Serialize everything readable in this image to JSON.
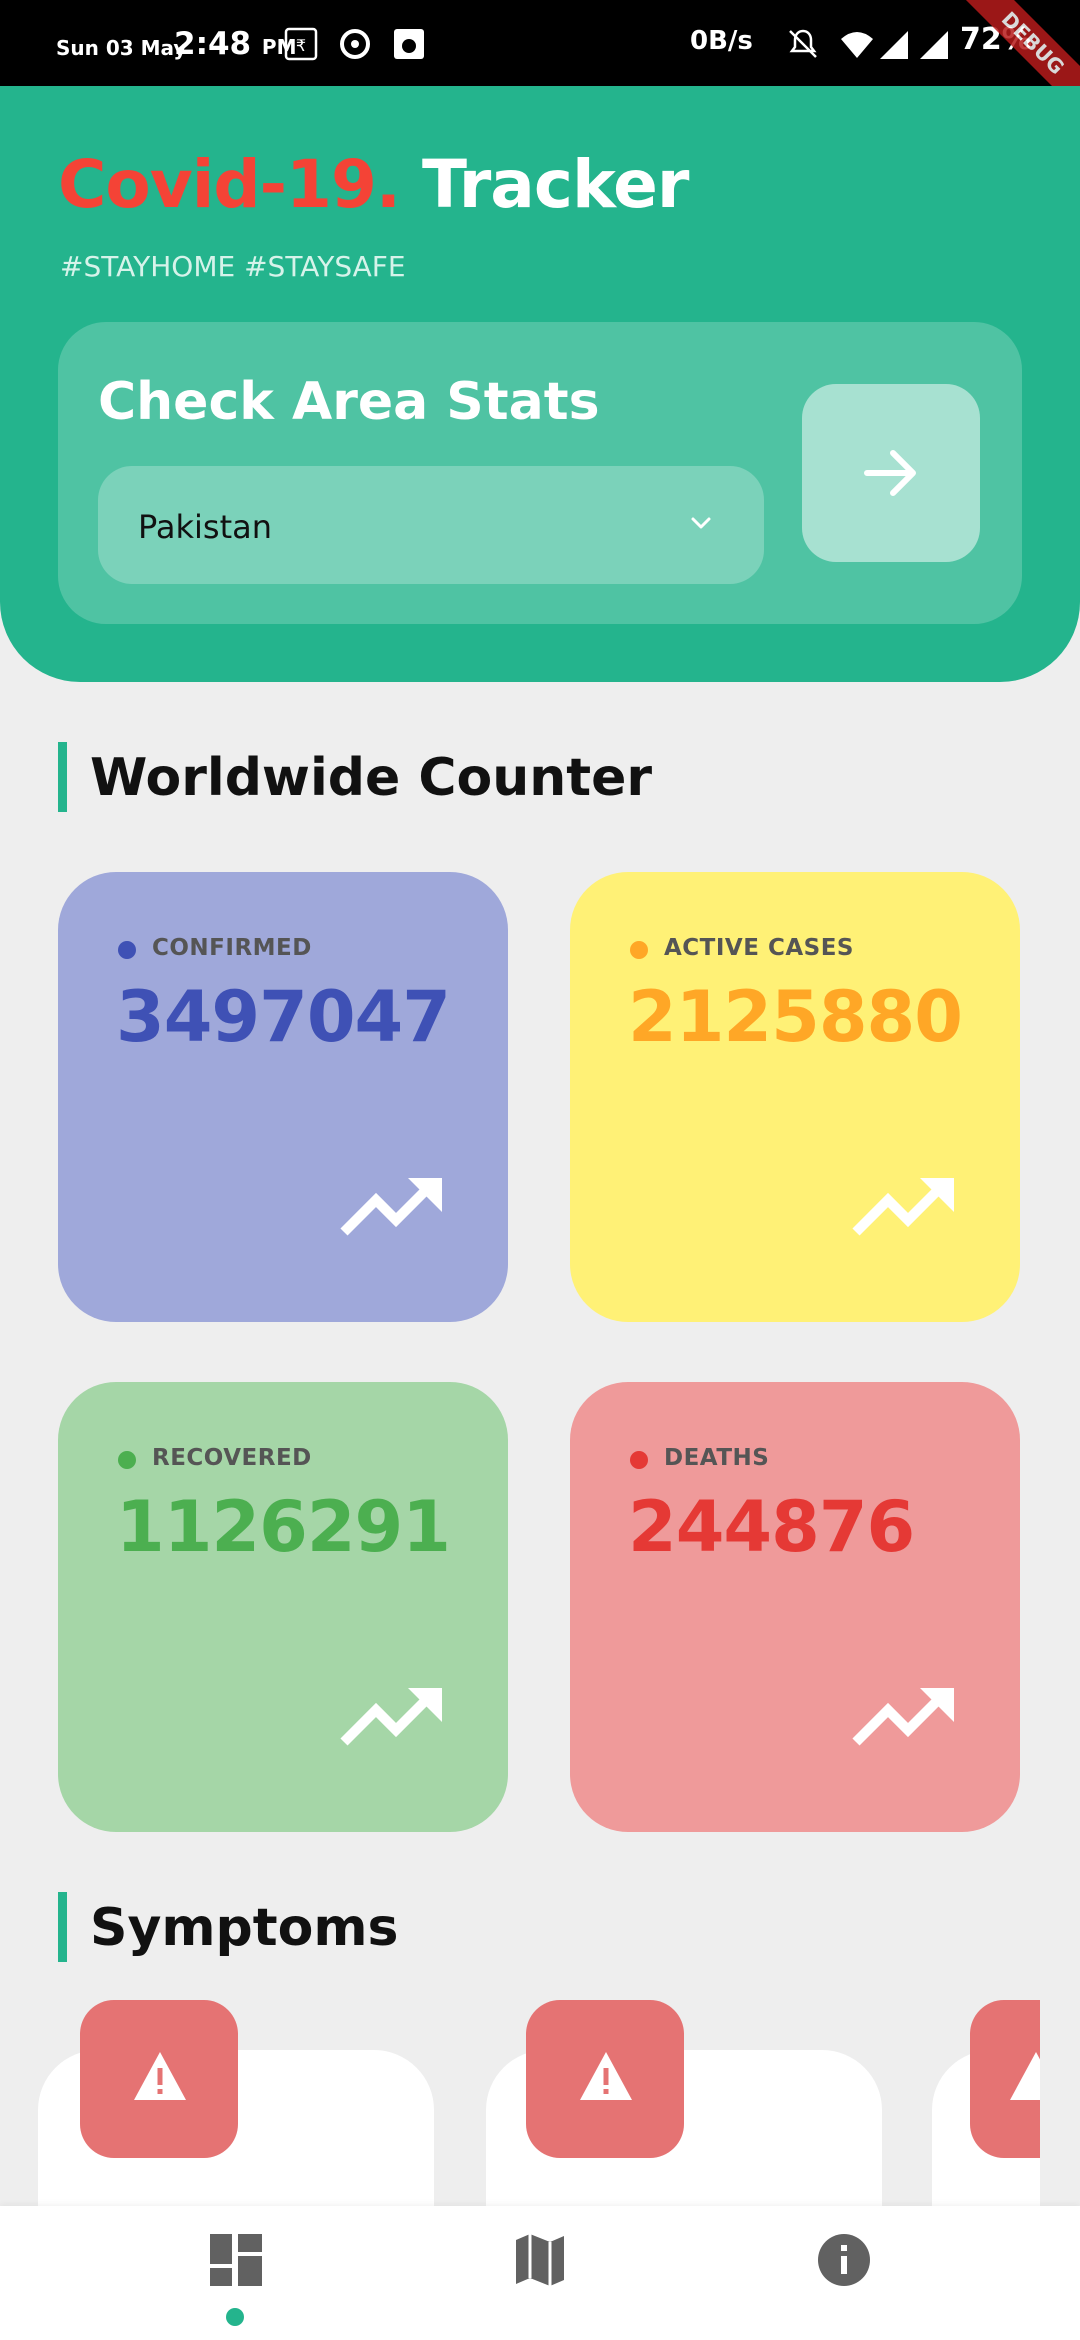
{
  "status_bar": {
    "date": "Sun 03 May",
    "time": "2:48",
    "ampm": "PM",
    "speed": "0B/s",
    "battery": "72%",
    "debug_banner": "DEBUG"
  },
  "header": {
    "title_part1": "Covid-19",
    "title_dot": ".",
    "title_part2": "Tracker",
    "hashtags": "#STAYHOME #STAYSAFE",
    "area_title": "Check Area Stats",
    "selected_country": "Pakistan",
    "colors": {
      "background": "#24b48d",
      "title_accent": "#f44336"
    }
  },
  "worldwide": {
    "heading": "Worldwide Counter",
    "cards": [
      {
        "label": "CONFIRMED",
        "value": "3497047",
        "bg": "#9fa8da",
        "accent": "#3f51b5"
      },
      {
        "label": "ACTIVE CASES",
        "value": "2125880",
        "bg": "#fff176",
        "accent": "#ffa726"
      },
      {
        "label": "RECOVERED",
        "value": "1126291",
        "bg": "#a5d6a7",
        "accent": "#4caf50"
      },
      {
        "label": "DEATHS",
        "value": "244876",
        "bg": "#ef9a9a",
        "accent": "#e53935"
      }
    ]
  },
  "symptoms": {
    "heading": "Symptoms",
    "icons": [
      "warning-icon",
      "warning-icon",
      "warning-icon"
    ]
  },
  "bottom_nav": {
    "items": [
      "dashboard-icon",
      "map-icon",
      "info-icon"
    ],
    "active_index": 0
  }
}
